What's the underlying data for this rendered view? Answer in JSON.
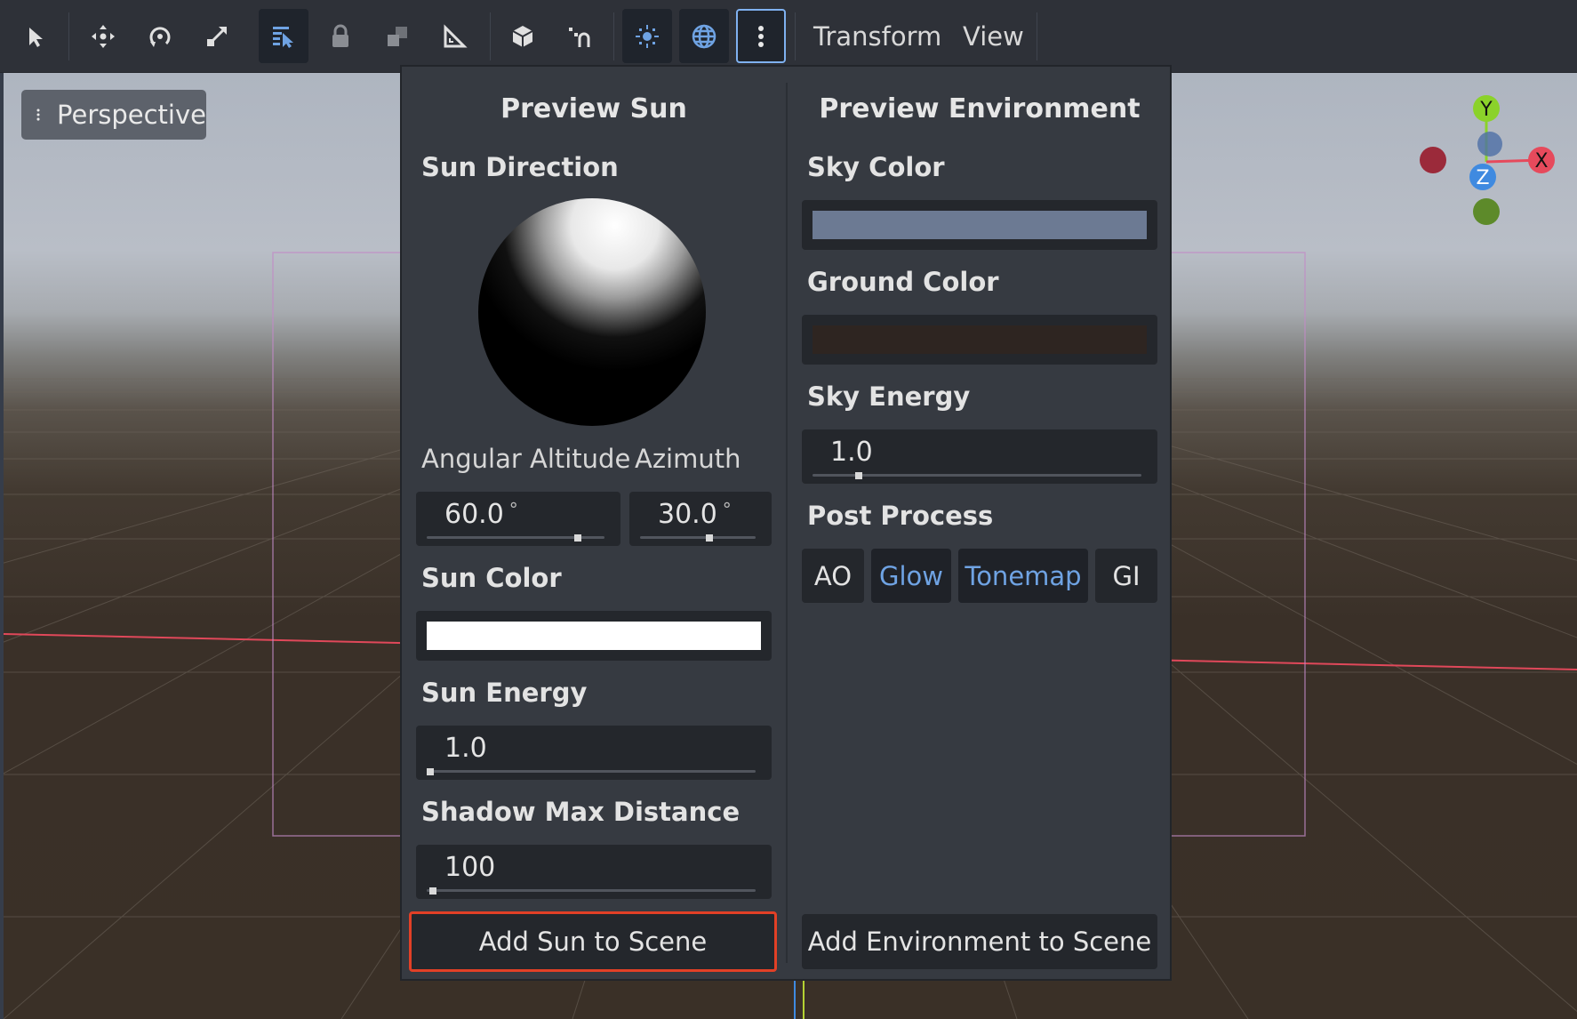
{
  "toolbar": {
    "buttons": [
      {
        "name": "select-tool-button",
        "icon": "arrow-cursor-icon"
      },
      {
        "name": "move-tool-button",
        "icon": "move-arrows-icon"
      },
      {
        "name": "rotate-tool-button",
        "icon": "rotate-icon"
      },
      {
        "name": "scale-tool-button",
        "icon": "scale-icon"
      },
      {
        "name": "list-select-button",
        "icon": "list-select-icon"
      },
      {
        "name": "lock-button",
        "icon": "lock-icon"
      },
      {
        "name": "group-button",
        "icon": "group-icon"
      },
      {
        "name": "ruler-button",
        "icon": "ruler-icon"
      },
      {
        "name": "local-space-button",
        "icon": "cube-icon"
      },
      {
        "name": "snap-button",
        "icon": "snap-magnet-icon"
      },
      {
        "name": "preview-sun-toggle",
        "icon": "sun-icon"
      },
      {
        "name": "preview-environment-toggle",
        "icon": "globe-icon"
      },
      {
        "name": "environment-settings-menu-button",
        "icon": "vertical-dots-icon"
      }
    ],
    "menus": {
      "transform": "Transform",
      "view": "View"
    }
  },
  "viewport": {
    "perspective_label": "Perspective"
  },
  "gizmo": {
    "y": "Y",
    "x": "X",
    "z": "Z"
  },
  "preview_sun": {
    "title": "Preview Sun",
    "sun_direction_label": "Sun Direction",
    "angular_altitude_label": "Angular Altitude",
    "azimuth_label": "Azimuth",
    "angular_altitude_value": "60.0",
    "azimuth_value": "30.0",
    "degree_symbol": "°",
    "angular_altitude_ratio": 0.85,
    "azimuth_ratio": 0.6,
    "sun_color_label": "Sun Color",
    "sun_color": "#ffffff",
    "sun_energy_label": "Sun Energy",
    "sun_energy_value": "1.0",
    "sun_energy_ratio": 0.01,
    "shadow_max_distance_label": "Shadow Max Distance",
    "shadow_max_distance_value": "100",
    "shadow_max_distance_ratio": 0.02,
    "add_button": "Add Sun to Scene"
  },
  "preview_environment": {
    "title": "Preview Environment",
    "sky_color_label": "Sky Color",
    "sky_color": "#6c7a93",
    "ground_color_label": "Ground Color",
    "ground_color": "#2e2521",
    "sky_energy_label": "Sky Energy",
    "sky_energy_value": "1.0",
    "sky_energy_ratio": 0.14,
    "post_process_label": "Post Process",
    "post_process": {
      "ao": "AO",
      "glow": "Glow",
      "tonemap": "Tonemap",
      "gi": "GI"
    },
    "add_button": "Add Environment to Scene"
  },
  "colors": {
    "accent": "#6fa3e3",
    "highlight_border": "#e24026"
  }
}
